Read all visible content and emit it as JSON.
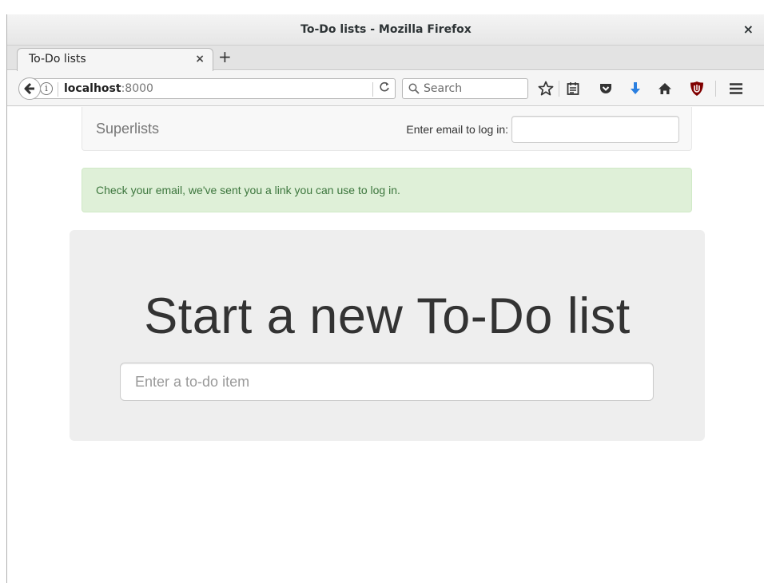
{
  "window": {
    "title": "To-Do lists - Mozilla Firefox",
    "close_glyph": "×"
  },
  "tabs": [
    {
      "label": "To-Do lists",
      "close_glyph": "×"
    }
  ],
  "new_tab_glyph": "+",
  "navbar": {
    "url_host": "localhost",
    "url_port": ":8000",
    "info_glyph": "i",
    "reload_glyph": "C",
    "search_placeholder": "Search",
    "icons": [
      "back-arrow-icon",
      "info-icon",
      "reload-icon",
      "search-icon",
      "bookmark-star-icon",
      "reading-list-icon",
      "pocket-icon",
      "downloads-icon",
      "home-icon",
      "ublock-icon",
      "menu-icon"
    ],
    "colors": {
      "downloads": "#2a7fe0",
      "ublock": "#800000"
    }
  },
  "site": {
    "brand": "Superlists",
    "login_label": "Enter email to log in:",
    "alert_message": "Check your email, we've sent you a link you can use to log in.",
    "heading": "Start a new To-Do list",
    "item_placeholder": "Enter a to-do item"
  },
  "colors": {
    "alert_bg": "#dff0d8",
    "alert_text": "#3c763d",
    "jumbotron_bg": "#eeeeee"
  }
}
